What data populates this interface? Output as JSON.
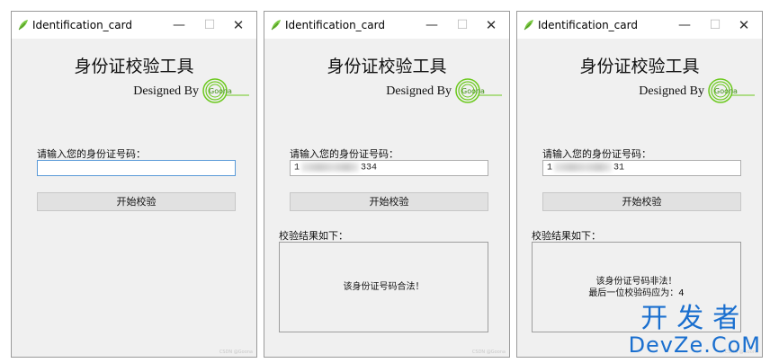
{
  "windows": [
    {
      "title": "Identification_card",
      "controls": {
        "minimize": "—",
        "maximize": "☐",
        "close": "✕"
      },
      "heading": "身份证校验工具",
      "designed_by": "Designed By",
      "logo_text": "Goona",
      "prompt": "请输入您的身份证号码：",
      "input": {
        "prefix": "",
        "suffix": ""
      },
      "button": "开始校验",
      "watermark": "CSDN @Goona"
    },
    {
      "title": "Identification_card",
      "controls": {
        "minimize": "—",
        "maximize": "☐",
        "close": "✕"
      },
      "heading": "身份证校验工具",
      "designed_by": "Designed By",
      "logo_text": "Goona",
      "prompt": "请输入您的身份证号码：",
      "input": {
        "prefix": "1",
        "suffix": "334"
      },
      "button": "开始校验",
      "result_label": "校验结果如下：",
      "result_lines": [
        "该身份证号码合法！",
        ""
      ],
      "watermark": "CSDN @Goona"
    },
    {
      "title": "Identification_card",
      "controls": {
        "minimize": "—",
        "maximize": "☐",
        "close": "✕"
      },
      "heading": "身份证校验工具",
      "designed_by": "Designed By",
      "logo_text": "Goona",
      "prompt": "请输入您的身份证号码：",
      "input": {
        "prefix": "1",
        "suffix": "31"
      },
      "button": "开始校验",
      "result_label": "校验结果如下：",
      "result_lines": [
        "该身份证号码非法！",
        "最后一位校验码应为：4"
      ],
      "watermark": "CSDN @Goona"
    }
  ],
  "site_watermark": {
    "cn": "开发者",
    "en": "DevZe.CoM"
  },
  "colors": {
    "logo_green": "#6cc91e",
    "accent_blue": "#1a6fcf"
  }
}
